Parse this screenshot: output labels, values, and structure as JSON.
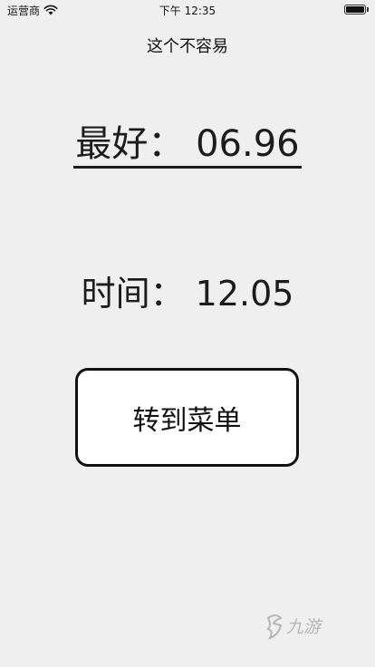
{
  "status_bar": {
    "carrier": "运营商",
    "time": "下午 12:35",
    "battery_level": 1.0,
    "wifi_icon": "wifi-icon",
    "battery_icon": "battery-icon"
  },
  "header": {
    "title": "这个不容易"
  },
  "best": {
    "label_with_value": "最好： 06.96"
  },
  "time": {
    "label_with_value": "时间： 12.05"
  },
  "menu_button": {
    "label": "转到菜单"
  },
  "watermark": {
    "text": "九游"
  }
}
